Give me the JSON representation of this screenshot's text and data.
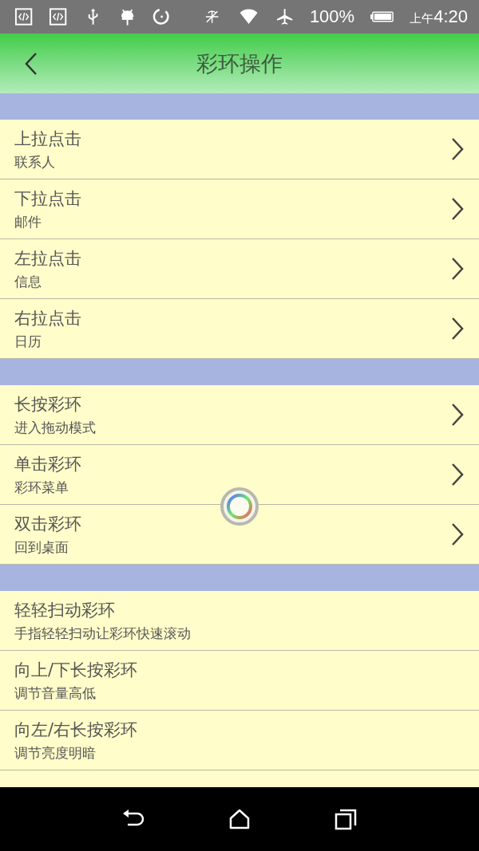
{
  "status_bar": {
    "battery": "100%",
    "am_pm": "上午",
    "time": "4:20"
  },
  "header": {
    "title": "彩环操作"
  },
  "sections": [
    {
      "items": [
        {
          "kind": "link",
          "title": "上拉点击",
          "subtitle": "联系人"
        },
        {
          "kind": "link",
          "title": "下拉点击",
          "subtitle": "邮件"
        },
        {
          "kind": "link",
          "title": "左拉点击",
          "subtitle": "信息"
        },
        {
          "kind": "link",
          "title": "右拉点击",
          "subtitle": "日历"
        }
      ]
    },
    {
      "items": [
        {
          "kind": "link",
          "title": "长按彩环",
          "subtitle": "进入拖动模式"
        },
        {
          "kind": "link",
          "title": "单击彩环",
          "subtitle": "彩环菜单"
        },
        {
          "kind": "link",
          "title": "双击彩环",
          "subtitle": "回到桌面"
        }
      ]
    },
    {
      "items": [
        {
          "kind": "info",
          "title": "轻轻扫动彩环",
          "subtitle": "手指轻轻扫动让彩环快速滚动"
        },
        {
          "kind": "info",
          "title": "向上/下长按彩环",
          "subtitle": "调节音量高低"
        },
        {
          "kind": "info",
          "title": "向左/右长按彩环",
          "subtitle": "调节亮度明暗"
        }
      ]
    }
  ]
}
